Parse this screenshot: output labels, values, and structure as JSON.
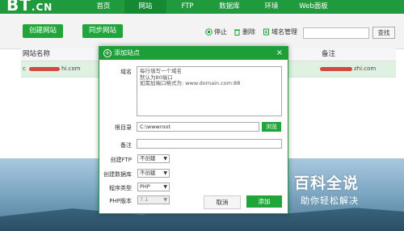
{
  "app": {
    "logo_main": "BT",
    "logo_suffix": ".CN"
  },
  "nav": {
    "items": [
      {
        "label": "首页",
        "active": false
      },
      {
        "label": "网站",
        "active": true
      },
      {
        "label": "FTP",
        "active": false
      },
      {
        "label": "数据库",
        "active": false
      },
      {
        "label": "环境",
        "active": false
      },
      {
        "label": "Web面板",
        "active": false
      }
    ]
  },
  "toolbar": {
    "create_site": "创建网站",
    "sync_site": "同步网站",
    "stop": "停止",
    "delete": "删除",
    "domain_manage": "域名管理",
    "search_button": "查找",
    "search_value": ""
  },
  "table": {
    "headers": {
      "name": "网站名称",
      "remark": "备注"
    },
    "rows": [
      {
        "name_prefix": "c",
        "name_suffix": "hi.com",
        "remark_suffix": "zhi.com"
      }
    ]
  },
  "dialog": {
    "title": "添加站点",
    "close_symbol": "×",
    "domain_label": "域名",
    "domain_hint": "每行填写一个域名\n默认为80端口\n如需加端口格式为: www.domain.com:88",
    "rootdir_label": "根目录",
    "rootdir_value": "C:\\wwwroot",
    "browse_button": "浏览",
    "remark_label": "备注",
    "remark_value": "",
    "ftp_label": "创建FTP",
    "ftp_value": "不创建",
    "db_label": "创建数据库",
    "db_value": "不创建",
    "type_label": "程序类型",
    "type_value": "PHP",
    "php_label": "PHP版本",
    "php_value": "7.1",
    "cancel_button": "取消",
    "ok_button": "添加"
  },
  "watermark": {
    "line1": "百科全说",
    "line2": "助你轻松解决"
  },
  "colors": {
    "accent": "#20a53a",
    "dark_green": "#1f9a3c",
    "row_highlight": "#dff2e2"
  }
}
